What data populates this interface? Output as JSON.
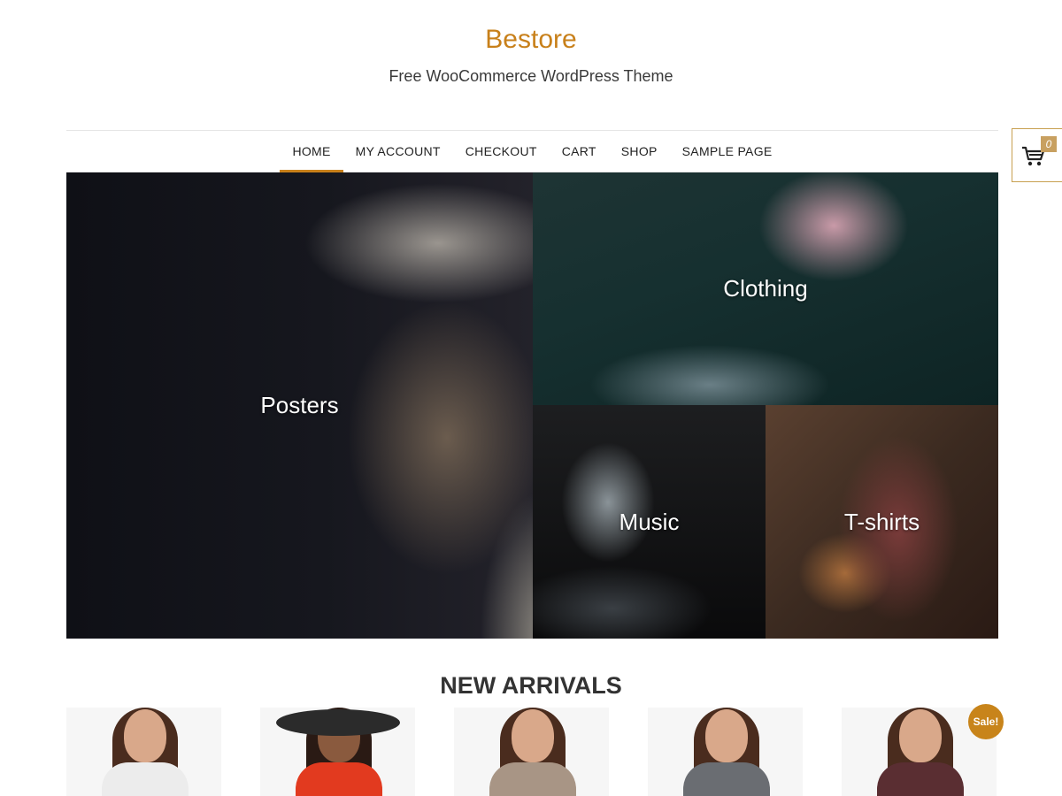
{
  "header": {
    "site_title": "Bestore",
    "tagline": "Free WooCommerce WordPress Theme"
  },
  "nav": {
    "items": [
      {
        "label": "HOME",
        "active": true
      },
      {
        "label": "MY ACCOUNT",
        "active": false
      },
      {
        "label": "CHECKOUT",
        "active": false
      },
      {
        "label": "CART",
        "active": false
      },
      {
        "label": "SHOP",
        "active": false
      },
      {
        "label": "SAMPLE PAGE",
        "active": false
      }
    ]
  },
  "cart": {
    "count": "0",
    "icon": "shopping-cart-icon"
  },
  "categories": [
    {
      "label": "Posters"
    },
    {
      "label": "Clothing"
    },
    {
      "label": "Music"
    },
    {
      "label": "T-shirts"
    }
  ],
  "new_arrivals": {
    "title": "NEW ARRIVALS",
    "sale_badge": "Sale!",
    "products": [
      {
        "top_color": "#ececec"
      },
      {
        "top_color": "#e23a1f"
      },
      {
        "top_color": "#a89585"
      },
      {
        "top_color": "#6a6d72"
      },
      {
        "top_color": "#5a2e32"
      }
    ]
  },
  "colors": {
    "accent": "#c8801a",
    "sale": "#c8841a"
  }
}
